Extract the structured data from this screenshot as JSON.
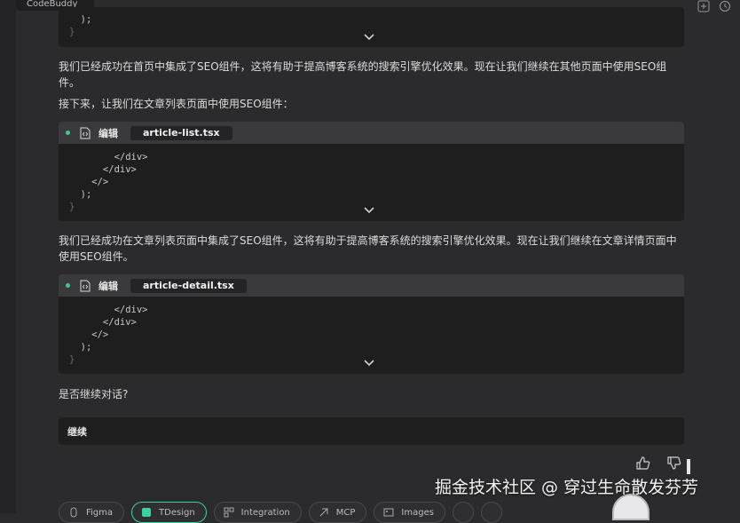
{
  "window": {
    "tab_title": "CodeBuddy"
  },
  "top_code": {
    "lines": [
      "  );",
      "}"
    ]
  },
  "messages": {
    "m1": "我们已经成功在首页中集成了SEO组件，这将有助于提高博客系统的搜索引擎优化效果。现在让我们继续在其他页面中使用SEO组件。",
    "m2": "接下来，让我们在文章列表页面中使用SEO组件：",
    "m3": "我们已经成功在文章列表页面中集成了SEO组件，这将有助于提高博客系统的搜索引擎优化效果。现在让我们继续在文章详情页面中使用SEO组件。",
    "m4": "是否继续对话?"
  },
  "code_blocks": [
    {
      "action": "编辑",
      "file": "article-list.tsx",
      "lines": [
        "        </div>",
        "      </div>",
        "    </>",
        "  );",
        "}"
      ]
    },
    {
      "action": "编辑",
      "file": "article-detail.tsx",
      "lines": [
        "        </div>",
        "      </div>",
        "    </>",
        "  );",
        "}"
      ]
    }
  ],
  "continue_label": "继续",
  "watermark": "掘金技术社区 @ 穿过生命散发芬芳",
  "bottom_chips": [
    "Figma",
    "TDesign",
    "Integration",
    "MCP",
    "Images"
  ],
  "colors": {
    "accent": "#3ecfa1",
    "status_dot": "#4cc38a"
  }
}
